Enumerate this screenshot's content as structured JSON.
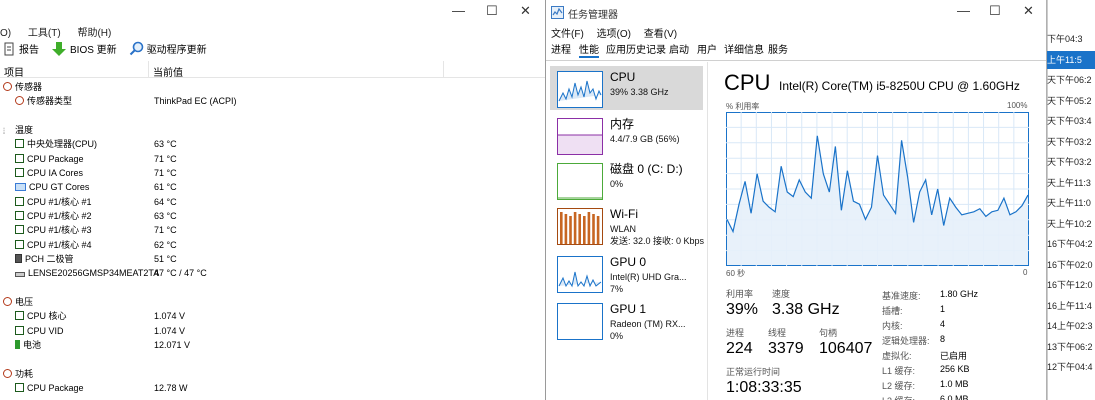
{
  "left": {
    "menu": [
      "O)",
      "工具(T)",
      "帮助(H)"
    ],
    "toolbar": [
      {
        "label": "报告",
        "icon": "report-icon"
      },
      {
        "label": "BIOS 更新",
        "icon": "download-icon"
      },
      {
        "label": "驱动程序更新",
        "icon": "search-icon"
      }
    ],
    "columns": [
      "项目",
      "当前值"
    ],
    "rows": [
      {
        "type": "cat",
        "label": "传感器",
        "icon": "sensor-icon",
        "value": ""
      },
      {
        "type": "item",
        "label": "传感器类型",
        "icon": "sensor-icon",
        "value": "ThinkPad EC  (ACPI)"
      },
      {
        "type": "gap"
      },
      {
        "type": "cat",
        "label": "温度",
        "icon": "thermometer-icon",
        "value": ""
      },
      {
        "type": "item",
        "label": "中央处理器(CPU)",
        "icon": "chip-icon",
        "value": "63 °C"
      },
      {
        "type": "item",
        "label": "CPU Package",
        "icon": "chip-icon",
        "value": "71 °C"
      },
      {
        "type": "item",
        "label": "CPU IA Cores",
        "icon": "chip-icon",
        "value": "71 °C"
      },
      {
        "type": "item",
        "label": "CPU GT Cores",
        "icon": "monitor-icon",
        "value": "61 °C"
      },
      {
        "type": "item",
        "label": "CPU #1/核心 #1",
        "icon": "chip-icon",
        "value": "64 °C"
      },
      {
        "type": "item",
        "label": "CPU #1/核心 #2",
        "icon": "chip-icon",
        "value": "63 °C"
      },
      {
        "type": "item",
        "label": "CPU #1/核心 #3",
        "icon": "chip-icon",
        "value": "71 °C"
      },
      {
        "type": "item",
        "label": "CPU #1/核心 #4",
        "icon": "chip-icon",
        "value": "62 °C"
      },
      {
        "type": "item",
        "label": "PCH 二极管",
        "icon": "pch-icon",
        "value": "51 °C"
      },
      {
        "type": "item",
        "label": "LENSE20256GMSP34MEAT2TA",
        "icon": "disk-icon",
        "value": "47 °C / 47 °C"
      },
      {
        "type": "gap"
      },
      {
        "type": "cat",
        "label": "电压",
        "icon": "voltage-icon",
        "value": ""
      },
      {
        "type": "item",
        "label": "CPU 核心",
        "icon": "chip-icon",
        "value": "1.074 V"
      },
      {
        "type": "item",
        "label": "CPU VID",
        "icon": "chip-icon",
        "value": "1.074 V"
      },
      {
        "type": "item",
        "label": "电池",
        "icon": "battery-icon",
        "value": "12.071 V"
      },
      {
        "type": "gap"
      },
      {
        "type": "cat",
        "label": "功耗",
        "icon": "power-icon",
        "value": ""
      },
      {
        "type": "item",
        "label": "CPU Package",
        "icon": "chip-icon",
        "value": "12.78 W"
      }
    ]
  },
  "tm": {
    "title": "任务管理器",
    "menu": [
      "文件(F)",
      "选项(O)",
      "查看(V)"
    ],
    "tabs": [
      "进程",
      "性能",
      "应用历史记录",
      "启动",
      "用户",
      "详细信息",
      "服务"
    ],
    "active_tab": 1,
    "side": [
      {
        "name": "CPU",
        "lines": [
          "39%  3.38 GHz"
        ],
        "color": "#1a73c9",
        "sel": true
      },
      {
        "name": "内存",
        "lines": [
          "4.4/7.9 GB (56%)"
        ],
        "color": "#8b2fa6",
        "sel": false
      },
      {
        "name": "磁盘 0 (C: D:)",
        "lines": [
          "0%"
        ],
        "color": "#4caa3a",
        "sel": false
      },
      {
        "name": "Wi-Fi",
        "lines": [
          "WLAN",
          "发送: 32.0  接收: 0 Kbps"
        ],
        "color": "#a54a10",
        "sel": false
      },
      {
        "name": "GPU 0",
        "lines": [
          "Intel(R) UHD Gra...",
          "7%"
        ],
        "color": "#1a73c9",
        "sel": false
      },
      {
        "name": "GPU 1",
        "lines": [
          "Radeon (TM) RX...",
          "0%"
        ],
        "color": "#1a73c9",
        "sel": false
      }
    ],
    "header_big": "CPU",
    "header_model": "Intel(R) Core(TM) i5-8250U CPU @ 1.60GHz",
    "graph_label": "% 利用率",
    "graph_max": "100%",
    "graph_left": "60 秒",
    "graph_right": "0",
    "graph_series": [
      30,
      22,
      40,
      55,
      34,
      60,
      42,
      38,
      35,
      65,
      48,
      45,
      56,
      48,
      44,
      85,
      60,
      48,
      78,
      36,
      62,
      42,
      40,
      30,
      38,
      72,
      46,
      40,
      34,
      82,
      58,
      28,
      48,
      56,
      33,
      50,
      26,
      44,
      38,
      33,
      34,
      35,
      37,
      32,
      35,
      36,
      44,
      33,
      35,
      39,
      46
    ],
    "stats": {
      "util_label": "利用率",
      "util": "39%",
      "speed_label": "速度",
      "speed": "3.38 GHz",
      "proc_label": "进程",
      "proc": "224",
      "thread_label": "线程",
      "thread": "3379",
      "handle_label": "句柄",
      "handle": "106407",
      "uptime_label": "正常运行时间",
      "uptime": "1:08:33:35"
    },
    "kv": [
      [
        "基准速度:",
        "1.80 GHz"
      ],
      [
        "插槽:",
        "1"
      ],
      [
        "内核:",
        "4"
      ],
      [
        "逻辑处理器:",
        "8"
      ],
      [
        "虚拟化:",
        "已启用"
      ],
      [
        "L1 缓存:",
        "256 KB"
      ],
      [
        "L2 缓存:",
        "1.0 MB"
      ],
      [
        "L3 缓存:",
        "6.0 MB"
      ]
    ]
  },
  "right": {
    "items": [
      {
        "text": "下午04:3",
        "sel": false
      },
      {
        "text": "上午11:5",
        "sel": true
      },
      {
        "text": "下午06:2",
        "sel": false
      },
      {
        "text": "下午05:2",
        "sel": false
      },
      {
        "text": "下午03:4",
        "sel": false
      },
      {
        "text": "下午03:2",
        "sel": false
      },
      {
        "text": "下午03:2",
        "sel": false
      },
      {
        "text": "上午11:3",
        "sel": false
      },
      {
        "text": "上午11:0",
        "sel": false
      },
      {
        "text": "上午10:2",
        "sel": false
      },
      {
        "text": "下午04:2",
        "sel": false
      },
      {
        "text": "下午02:0",
        "sel": false
      },
      {
        "text": "下午12:0",
        "sel": false
      },
      {
        "text": "上午11:4",
        "sel": false
      },
      {
        "text": "上午02:3",
        "sel": false
      },
      {
        "text": "下午06:2",
        "sel": false
      },
      {
        "text": "下午04:4",
        "sel": false
      }
    ],
    "prefixes": [
      "",
      "",
      "天",
      "天",
      "天",
      "天",
      "天",
      "天",
      "天",
      "天",
      "16",
      "16",
      "16",
      "16",
      "14",
      "13",
      "12"
    ]
  }
}
